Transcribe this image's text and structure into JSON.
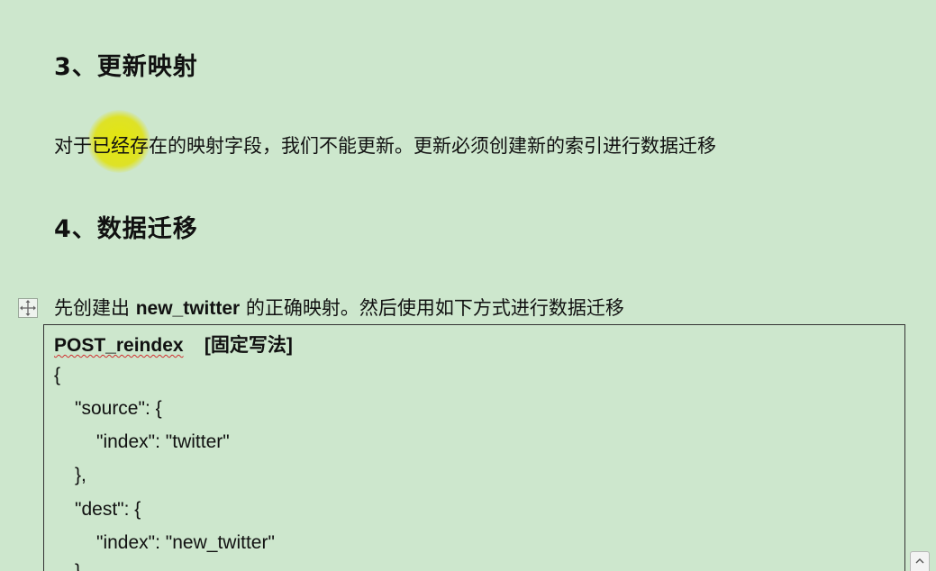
{
  "section3": {
    "heading": "3、更新映射",
    "text": "对于已经存在的映射字段，我们不能更新。更新必须创建新的索引进行数据迁移"
  },
  "section4": {
    "heading": "4、数据迁移",
    "intro_before": "先创建出 ",
    "intro_bold": "new_twitter",
    "intro_after": " 的正确映射。然后使用如下方式进行数据迁移"
  },
  "code": {
    "request_method_path": "POST_reindex",
    "request_note": "[固定写法]",
    "lines": [
      "{",
      "\"source\": {",
      "\"index\": \"twitter\"",
      "},",
      "\"dest\": {",
      "\"index\": \"new_twitter\"",
      "}"
    ]
  },
  "icons": {
    "move_handle": "move-cross-icon",
    "scroll": "scroll-button-icon"
  },
  "colors": {
    "page_background": "#cde7cd",
    "cursor_highlight": "#e6e600",
    "spellcheck_underline": "#d03030"
  }
}
